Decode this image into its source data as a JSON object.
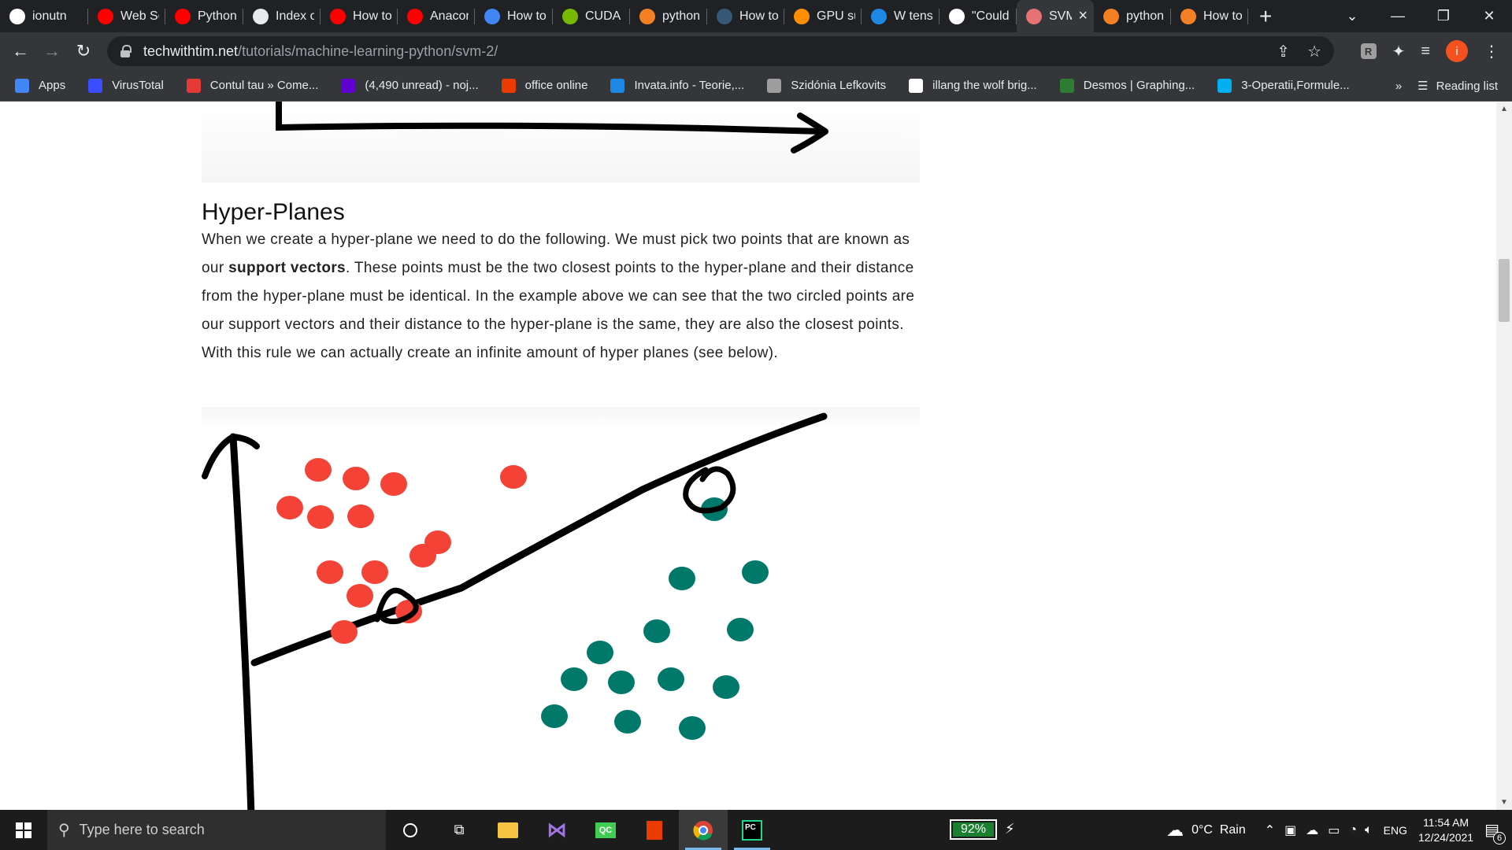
{
  "browser": {
    "tabs": [
      {
        "label": "ionutn",
        "icon": "github-icon",
        "color": "#ffffff",
        "width": 112
      },
      {
        "label": "Web Sc",
        "icon": "youtube-icon",
        "color": "#ff0000",
        "width": 98
      },
      {
        "label": "Python",
        "icon": "youtube-icon",
        "color": "#ff0000",
        "width": 99
      },
      {
        "label": "Index o",
        "icon": "globe-icon",
        "color": "#e8eaed",
        "width": 98
      },
      {
        "label": "How to",
        "icon": "youtube-icon",
        "color": "#ff0000",
        "width": 98
      },
      {
        "label": "Anacon",
        "icon": "youtube-icon",
        "color": "#ff0000",
        "width": 98
      },
      {
        "label": "How to",
        "icon": "tool-icon",
        "color": "#4285f4",
        "width": 99
      },
      {
        "label": "CUDA T",
        "icon": "nvidia-icon",
        "color": "#76b900",
        "width": 98
      },
      {
        "label": "python",
        "icon": "stackoverflow-icon",
        "color": "#f48024",
        "width": 98
      },
      {
        "label": "How to",
        "icon": "tds-icon",
        "color": "#355876",
        "width": 98
      },
      {
        "label": "GPU su",
        "icon": "tensorflow-icon",
        "color": "#ff8f00",
        "width": 98
      },
      {
        "label": "W tens",
        "icon": "circle-icon",
        "color": "#1e88e5",
        "width": 99
      },
      {
        "label": "\"Could",
        "icon": "github-icon",
        "color": "#ffffff",
        "width": 98
      },
      {
        "label": "SVM",
        "icon": "techwithtim-icon",
        "color": "#e57373",
        "width": 98,
        "active": true
      },
      {
        "label": "python",
        "icon": "stackoverflow-icon",
        "color": "#f48024",
        "width": 98
      },
      {
        "label": "How to",
        "icon": "stackoverflow-icon",
        "color": "#f48024",
        "width": 98
      }
    ],
    "url_host": "techwithtim.net",
    "url_path": "/tutorials/machine-learning-python/svm-2/",
    "bookmarks": [
      {
        "label": "Apps",
        "icon": "apps-grid-icon",
        "color": "#4285f4"
      },
      {
        "label": "VirusTotal",
        "icon": "virustotal-icon",
        "color": "#394eff"
      },
      {
        "label": "Contul tau » Come...",
        "icon": "emag-icon",
        "color": "#e53935"
      },
      {
        "label": "(4,490 unread) - noj...",
        "icon": "yahoo-mail-icon",
        "color": "#6001d2"
      },
      {
        "label": "office online",
        "icon": "office-icon",
        "color": "#eb3c00"
      },
      {
        "label": "Invata.info - Teorie,...",
        "icon": "invata-icon",
        "color": "#1e88e5"
      },
      {
        "label": "Szidónia Lefkovits",
        "icon": "globe-icon",
        "color": "#9e9e9e"
      },
      {
        "label": "illang the wolf brig...",
        "icon": "google-icon",
        "color": "#ffffff"
      },
      {
        "label": "Desmos | Graphing...",
        "icon": "desmos-icon",
        "color": "#2e7d32"
      },
      {
        "label": "3-Operatii,Formule...",
        "icon": "skype-icon",
        "color": "#00aff0"
      }
    ],
    "overflow_label": "»",
    "reading_list_label": "Reading list",
    "profile_initial": "i"
  },
  "article": {
    "heading": "Hyper-Planes",
    "para_1": "When we create a hyper-plane we need to do the following. We must pick two points that are known as our ",
    "para_bold": "support vectors",
    "para_2": ". These points must be the two closest points to the hyper-plane and their distance from the hyper-plane must be identical. In the example above we can see that the two circled points are our support vectors and their distance to the hyper-plane is the same, they are also the closest points. With this rule we can actually create an infinite amount of hyper planes (see below).",
    "figure": {
      "red_color": "#f44336",
      "green_color": "#00796b"
    }
  },
  "taskbar": {
    "search_placeholder": "Type here to search",
    "battery_label": "92%",
    "battery_level": 0.92,
    "weather": "0°C  Rain",
    "language": "ENG",
    "time": "11:54 AM",
    "date": "12/24/2021",
    "notifications": "6"
  }
}
